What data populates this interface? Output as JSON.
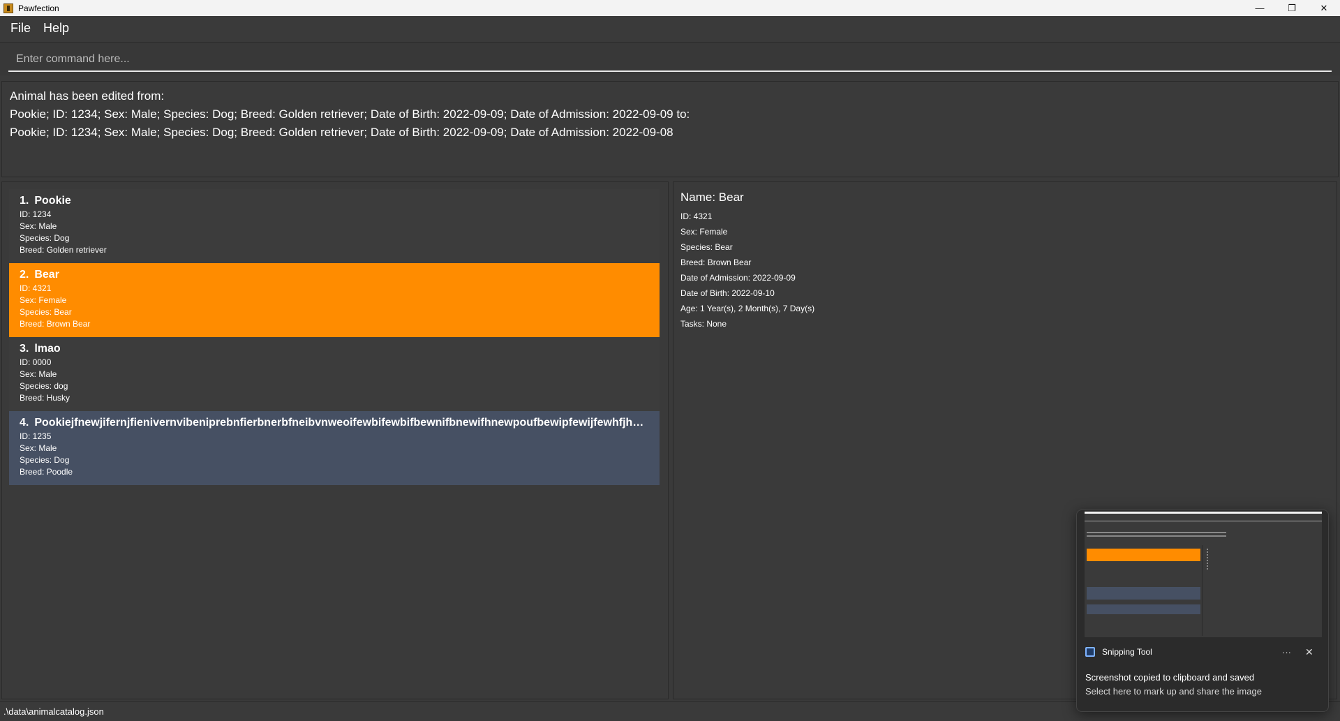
{
  "window": {
    "title": "Pawfection",
    "minimize_icon": "minimize-icon",
    "restore_icon": "restore-icon",
    "close_icon": "close-icon"
  },
  "menu": {
    "file": "File",
    "help": "Help"
  },
  "command": {
    "placeholder": "Enter command here..."
  },
  "result": {
    "line1": "Animal has been edited from:",
    "line2": "Pookie; ID: 1234; Sex: Male; Species: Dog; Breed: Golden retriever; Date of Birth: 2022-09-09; Date of Admission: 2022-09-09 to:",
    "line3": "Pookie; ID: 1234; Sex: Male; Species: Dog; Breed: Golden retriever; Date of Birth: 2022-09-09; Date of Admission: 2022-09-08"
  },
  "animals": [
    {
      "index": "1.",
      "name": "Pookie",
      "id": "ID: 1234",
      "sex": "Sex: Male",
      "species": "Species: Dog",
      "breed": "Breed: Golden retriever"
    },
    {
      "index": "2.",
      "name": "Bear",
      "id": "ID: 4321",
      "sex": "Sex: Female",
      "species": "Species: Bear",
      "breed": "Breed: Brown Bear"
    },
    {
      "index": "3.",
      "name": "lmao",
      "id": "ID: 0000",
      "sex": "Sex: Male",
      "species": "Species: dog",
      "breed": "Breed: Husky"
    },
    {
      "index": "4.",
      "name": "Pookiejfnewjifernjfienivernvibeniprebnfierbnerbfneibvnweoifewbifewbifbewnifbnewifhnewpoufbewipfewijfewhfjhewwef...",
      "id": "ID: 1235",
      "sex": "Sex: Male",
      "species": "Species: Dog",
      "breed": "Breed: Poodle"
    }
  ],
  "detail": {
    "name": "Name: Bear",
    "id": "ID: 4321",
    "sex": "Sex: Female",
    "species": "Species: Bear",
    "breed": "Breed: Brown Bear",
    "admission": "Date of Admission: 2022-09-09",
    "birth": "Date of Birth: 2022-09-10",
    "age": "Age: 1 Year(s), 2 Month(s), 7 Day(s)",
    "tasks": "Tasks: None"
  },
  "status": {
    "path": ".\\data\\animalcatalog.json"
  },
  "toast": {
    "app": "Snipping Tool",
    "more": "···",
    "close": "✕",
    "message": "Screenshot copied to clipboard and saved",
    "sub": "Select here to mark up and share the image"
  },
  "colors": {
    "background": "#3a3a3a",
    "selected": "#ff8c00",
    "highlight": "#465063"
  }
}
